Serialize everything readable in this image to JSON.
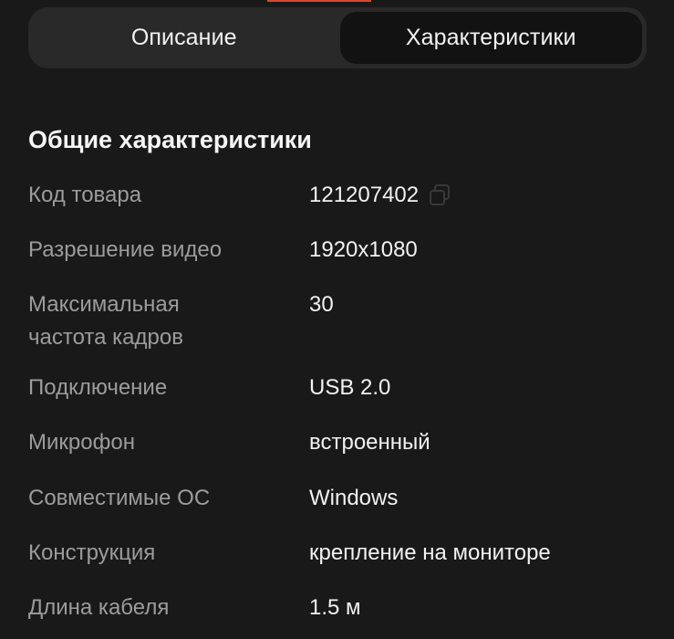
{
  "tabs": [
    {
      "label": "Описание",
      "active": false
    },
    {
      "label": "Характеристики",
      "active": true
    }
  ],
  "section": {
    "title": "Общие характеристики"
  },
  "specs": [
    {
      "label": "Код товара",
      "value": "121207402",
      "icon": "copy-icon"
    },
    {
      "label": "Разрешение видео",
      "value": "1920x1080"
    },
    {
      "label": "Максимальная\nчастота кадров",
      "value": "30"
    },
    {
      "label": "Подключение",
      "value": "USB 2.0"
    },
    {
      "label": "Микрофон",
      "value": "встроенный"
    },
    {
      "label": "Совместимые ОС",
      "value": "Windows"
    },
    {
      "label": "Конструкция",
      "value": "крепление на мониторе"
    },
    {
      "label": "Длина кабеля",
      "value": "1.5 м"
    }
  ],
  "colors": {
    "background": "#1a1919",
    "tab_container": "#2a2929",
    "tab_active": "#121212",
    "label_text": "#9d9c9c",
    "value_text": "#f2f2f2",
    "accent": "#d9492c"
  }
}
